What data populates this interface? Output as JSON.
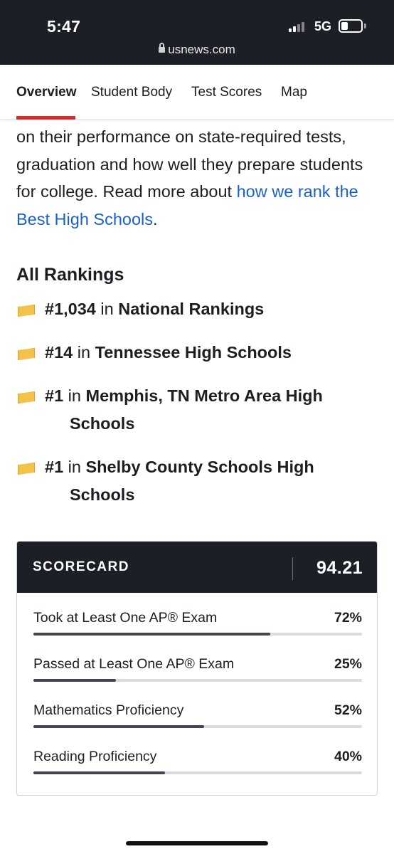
{
  "status_bar": {
    "time": "5:47",
    "network": "5G",
    "signal_bars": 4
  },
  "browser": {
    "url": "usnews.com"
  },
  "tabs": [
    {
      "label": "Overview",
      "active": true
    },
    {
      "label": "Student Body",
      "active": false
    },
    {
      "label": "Test Scores",
      "active": false
    },
    {
      "label": "Map",
      "active": false
    }
  ],
  "intro": {
    "text": "on their performance on state-required tests, graduation and how well they prepare students for college. Read more about ",
    "link": "how we rank the Best High Schools",
    "after": "."
  },
  "rankings": {
    "title": "All Rankings",
    "items": [
      {
        "rank": "#1,034",
        "in": "in",
        "name": "National Rankings"
      },
      {
        "rank": "#14",
        "in": "in",
        "name": "Tennessee High Schools"
      },
      {
        "rank": "#1",
        "in": "in",
        "name": "Memphis, TN Metro Area High",
        "name_cont": "Schools"
      },
      {
        "rank": "#1",
        "in": "in",
        "name": "Shelby County Schools High",
        "name_cont": "Schools"
      }
    ]
  },
  "scorecard": {
    "label": "SCORECARD",
    "score": "94.21",
    "metrics": [
      {
        "name": "Took at Least One AP® Exam",
        "value": "72%",
        "fraction": 0.72
      },
      {
        "name": "Passed at Least One AP® Exam",
        "value": "25%",
        "fraction": 0.25
      },
      {
        "name": "Mathematics Proficiency",
        "value": "52%",
        "fraction": 0.52
      },
      {
        "name": "Reading Proficiency",
        "value": "40%",
        "fraction": 0.4
      }
    ]
  },
  "colors": {
    "dark": "#1c1f26",
    "accent_red": "#d82b2b",
    "link_blue": "#1a62c6",
    "flag_gold": "#f2c24b"
  }
}
